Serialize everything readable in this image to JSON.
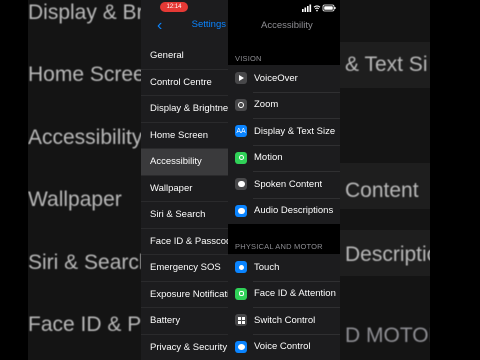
{
  "status_bar": {
    "time": "12:14",
    "icons": [
      "signal-icon",
      "wifi-icon",
      "battery-icon"
    ]
  },
  "backdrop": {
    "left_rows": [
      "Display & Brigh",
      "Home Scree",
      "Accessibility",
      "Wallpaper",
      "Siri & Search",
      "Face ID & Pa"
    ],
    "right_rows": [
      "& Text Si",
      "Content",
      "Description",
      "D MOTOR"
    ]
  },
  "sidebar": {
    "back_label": "‹",
    "title": "Settings",
    "items": [
      {
        "label": "General"
      },
      {
        "label": "Control Centre"
      },
      {
        "label": "Display & Brightness"
      },
      {
        "label": "Home Screen"
      },
      {
        "label": "Accessibility",
        "selected": true
      },
      {
        "label": "Wallpaper"
      },
      {
        "label": "Siri & Search"
      },
      {
        "label": "Face ID & Passcode"
      },
      {
        "label": "Emergency SOS"
      },
      {
        "label": "Exposure Notifications"
      },
      {
        "label": "Battery"
      },
      {
        "label": "Privacy & Security"
      }
    ]
  },
  "detail": {
    "title": "Accessibility",
    "vision": {
      "header": "VISION",
      "items": [
        {
          "label": "VoiceOver",
          "icon": "voiceover-icon"
        },
        {
          "label": "Zoom",
          "icon": "zoom-icon"
        },
        {
          "label": "Display & Text Size",
          "icon": "text-size-icon"
        },
        {
          "label": "Motion",
          "icon": "motion-icon"
        },
        {
          "label": "Spoken Content",
          "icon": "spoken-content-icon"
        },
        {
          "label": "Audio Descriptions",
          "icon": "audio-descriptions-icon"
        }
      ]
    },
    "physical": {
      "header": "PHYSICAL AND MOTOR",
      "items": [
        {
          "label": "Touch",
          "icon": "touch-icon"
        },
        {
          "label": "Face ID & Attention",
          "icon": "face-id-icon"
        },
        {
          "label": "Switch Control",
          "icon": "switch-control-icon"
        },
        {
          "label": "Voice Control",
          "icon": "voice-control-icon"
        }
      ]
    }
  },
  "colors": {
    "accent": "#0a84ff",
    "status_pill": "#e53935",
    "selected_row": "#3a3a3c"
  }
}
